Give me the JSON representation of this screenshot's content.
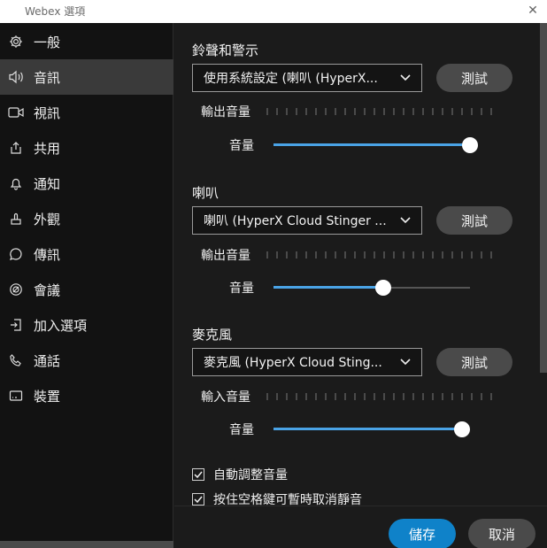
{
  "window": {
    "title": "Webex 選項",
    "close_glyph": "✕"
  },
  "sidebar": {
    "items": [
      {
        "label": "一般",
        "icon": "gear-icon"
      },
      {
        "label": "音訊",
        "icon": "speaker-icon",
        "active": true
      },
      {
        "label": "視訊",
        "icon": "video-icon"
      },
      {
        "label": "共用",
        "icon": "share-icon"
      },
      {
        "label": "通知",
        "icon": "bell-icon"
      },
      {
        "label": "外觀",
        "icon": "appearance-icon"
      },
      {
        "label": "傳訊",
        "icon": "chat-icon"
      },
      {
        "label": "會議",
        "icon": "meeting-icon"
      },
      {
        "label": "加入選項",
        "icon": "join-icon"
      },
      {
        "label": "通話",
        "icon": "phone-icon"
      },
      {
        "label": "裝置",
        "icon": "device-icon"
      }
    ]
  },
  "ringtones": {
    "title": "鈴聲和警示",
    "device": "使用系統設定 (喇叭 (HyperX...",
    "test_label": "測試",
    "meter_label": "輸出音量",
    "volume_label": "音量",
    "volume_level": 1.0
  },
  "speaker": {
    "title": "喇叭",
    "device": "喇叭 (HyperX Cloud Stinger ...",
    "test_label": "測試",
    "meter_label": "輸出音量",
    "volume_label": "音量",
    "volume_level": 0.56
  },
  "microphone": {
    "title": "麥克風",
    "device": "麥克風 (HyperX Cloud Sting...",
    "test_label": "測試",
    "meter_label": "輸入音量",
    "volume_label": "音量",
    "volume_level": 0.96
  },
  "options": {
    "auto_adjust": {
      "label": "自動調整音量",
      "checked": true
    },
    "space_unmute": {
      "label": "按住空格鍵可暫時取消靜音",
      "checked": true
    }
  },
  "footer": {
    "save_label": "儲存",
    "cancel_label": "取消"
  },
  "colors": {
    "accent": "#4aa3e6",
    "primary_button": "#0f82c9",
    "active_nav": "#3a3a3a"
  }
}
